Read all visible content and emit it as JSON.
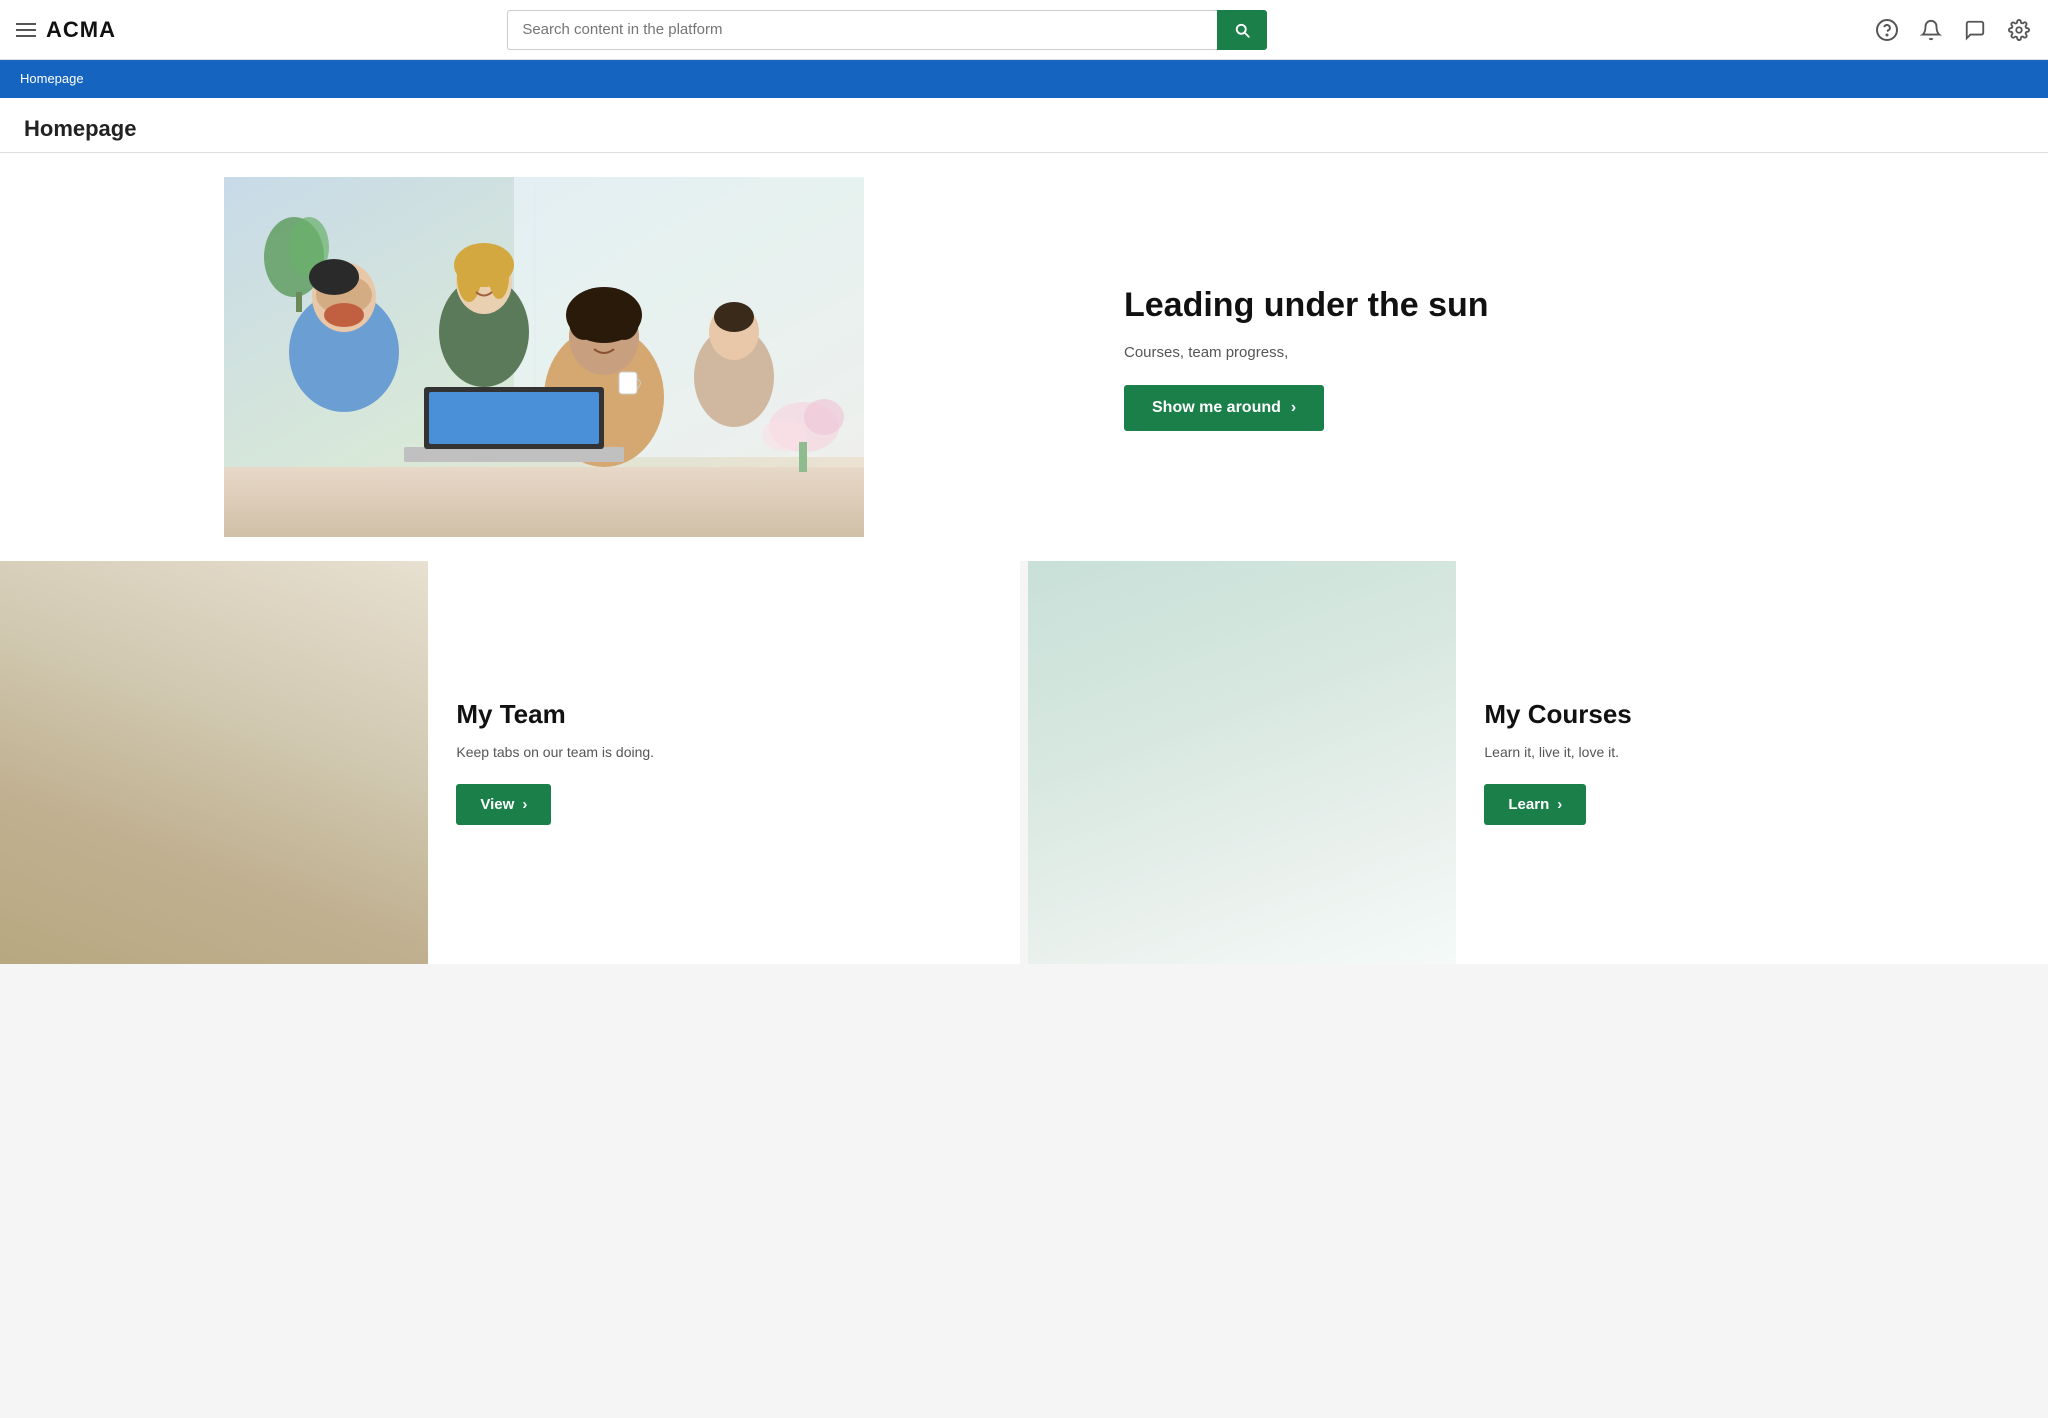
{
  "app": {
    "logo": "ACMA",
    "hamburger_label": "Menu"
  },
  "search": {
    "placeholder": "Search content in the platform",
    "button_label": "Search"
  },
  "nav_icons": {
    "help": "?",
    "bell": "🔔",
    "chat": "💬",
    "settings": "⚙"
  },
  "breadcrumb": {
    "text": "Homepage"
  },
  "page": {
    "title": "Homepage"
  },
  "hero": {
    "title": "Leading under the sun",
    "subtitle": "Courses, team progress,",
    "cta_label": "Show me around",
    "cta_arrow": "›"
  },
  "cards": [
    {
      "id": "my-team",
      "title": "My Team",
      "description": "Keep tabs on our team is doing.",
      "cta_label": "View",
      "cta_arrow": "›"
    },
    {
      "id": "my-courses",
      "title": "My Courses",
      "description": "Learn it, live it, love it.",
      "cta_label": "Learn",
      "cta_arrow": "›"
    }
  ],
  "colors": {
    "primary_green": "#1b7f4a",
    "nav_blue": "#1565c0",
    "text_dark": "#111111",
    "text_muted": "#555555"
  }
}
